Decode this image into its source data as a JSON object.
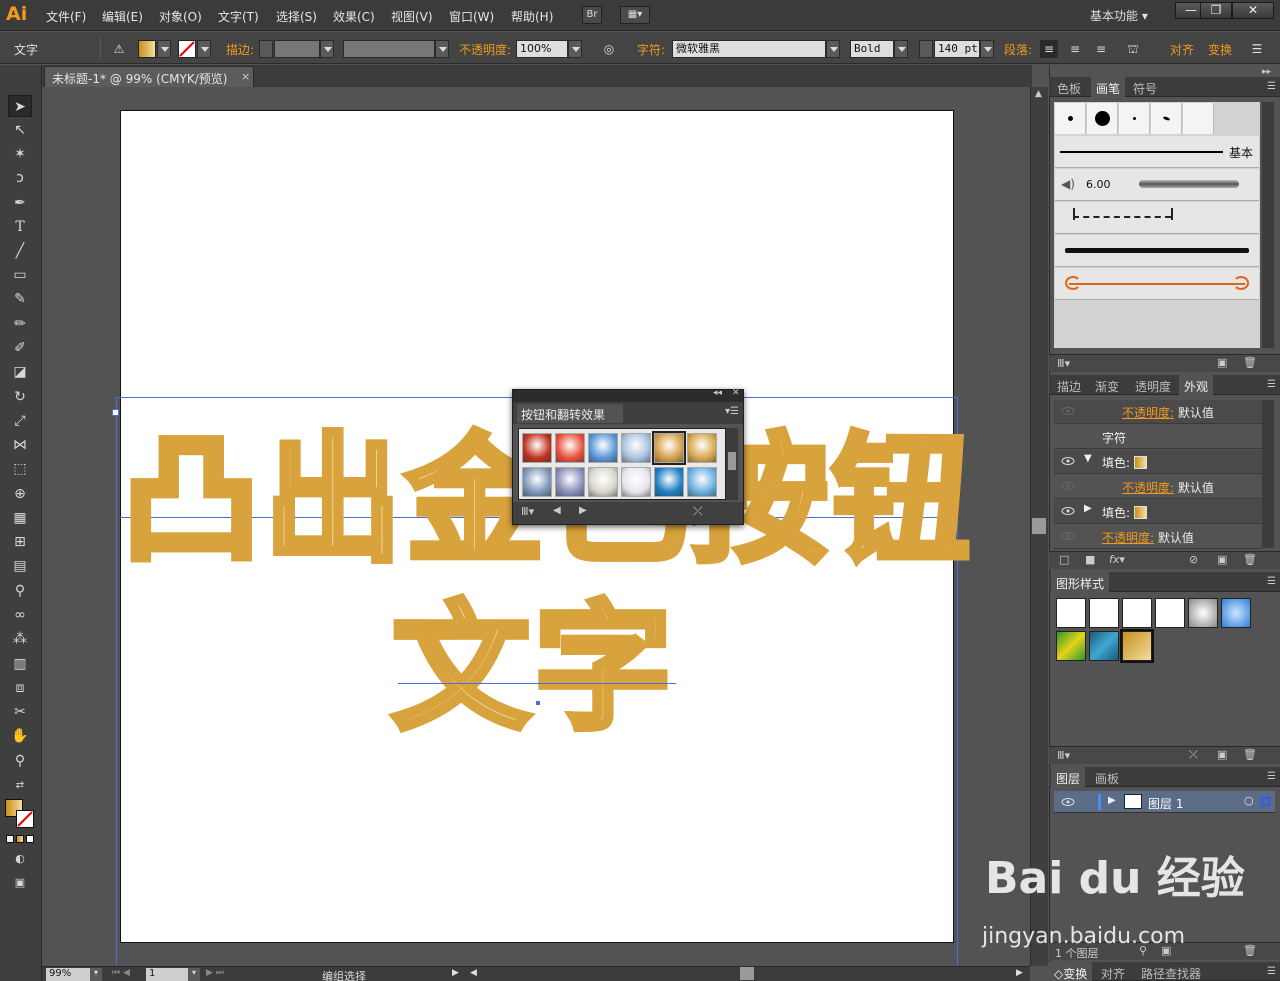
{
  "app": {
    "logo": "Ai",
    "menu": [
      "文件(F)",
      "编辑(E)",
      "对象(O)",
      "文字(T)",
      "选择(S)",
      "效果(C)",
      "视图(V)",
      "窗口(W)",
      "帮助(H)"
    ],
    "bridge_button": "Br",
    "workspace": "基本功能",
    "window_buttons": [
      "—",
      "❐",
      "✕"
    ]
  },
  "controlbar": {
    "tool_name": "文字",
    "stroke_label": "描边:",
    "opacity_label": "不透明度:",
    "opacity_value": "100%",
    "char_label": "字符:",
    "font_name": "微软雅黑",
    "font_style": "Bold",
    "font_size": "140 pt",
    "para_label": "段落:",
    "align_label": "对齐",
    "transform_label": "变换"
  },
  "document": {
    "tab_title": "未标题-1* @ 99% (CMYK/预览)",
    "tab_close": "×",
    "line1": "凸出金色按钮",
    "line2": "文字"
  },
  "statusbar": {
    "zoom": "99%",
    "page": "1",
    "status": "编组选择"
  },
  "float_panel": {
    "title": "按钮和翻转效果",
    "swatch_colors": [
      "#c0321f",
      "#e8503a",
      "#5a96d8",
      "#a9c4e0",
      "#d6a24a",
      "#d8a84e",
      "#7d96b8",
      "#8a8fb8",
      "#d9d6cc",
      "#e6e6ee",
      "#1c7fc4",
      "#6ab0e0"
    ]
  },
  "brush_panel": {
    "tabs": [
      "色板",
      "画笔",
      "符号"
    ],
    "active_tab": "画笔",
    "basic_label": "基本",
    "brush_size": "6.00"
  },
  "appearance_panel": {
    "tabs": [
      "描边",
      "渐变",
      "透明度",
      "外观"
    ],
    "active_tab": "外观",
    "rows": [
      {
        "label": "不透明度:",
        "value": "默认值",
        "orange": true
      },
      {
        "label": "字符",
        "value": "",
        "orange": false
      },
      {
        "label": "填色:",
        "value": "",
        "orange": false
      },
      {
        "label": "不透明度:",
        "value": "默认值",
        "orange": true
      },
      {
        "label": "填色:",
        "value": "",
        "orange": false
      },
      {
        "label": "不透明度:",
        "value": "默认值",
        "orange": true
      }
    ]
  },
  "graphic_styles_panel": {
    "title": "图形样式"
  },
  "layers_panel": {
    "tabs": [
      "图层",
      "画板"
    ],
    "active_tab": "图层",
    "layer_name": "图层 1",
    "count": "1 个图层"
  },
  "bottom_panel_tabs": [
    "◇变换",
    "对齐",
    "路径查找器"
  ],
  "watermark": {
    "brand": "Bai du 经验",
    "url": "jingyan.baidu.com"
  }
}
